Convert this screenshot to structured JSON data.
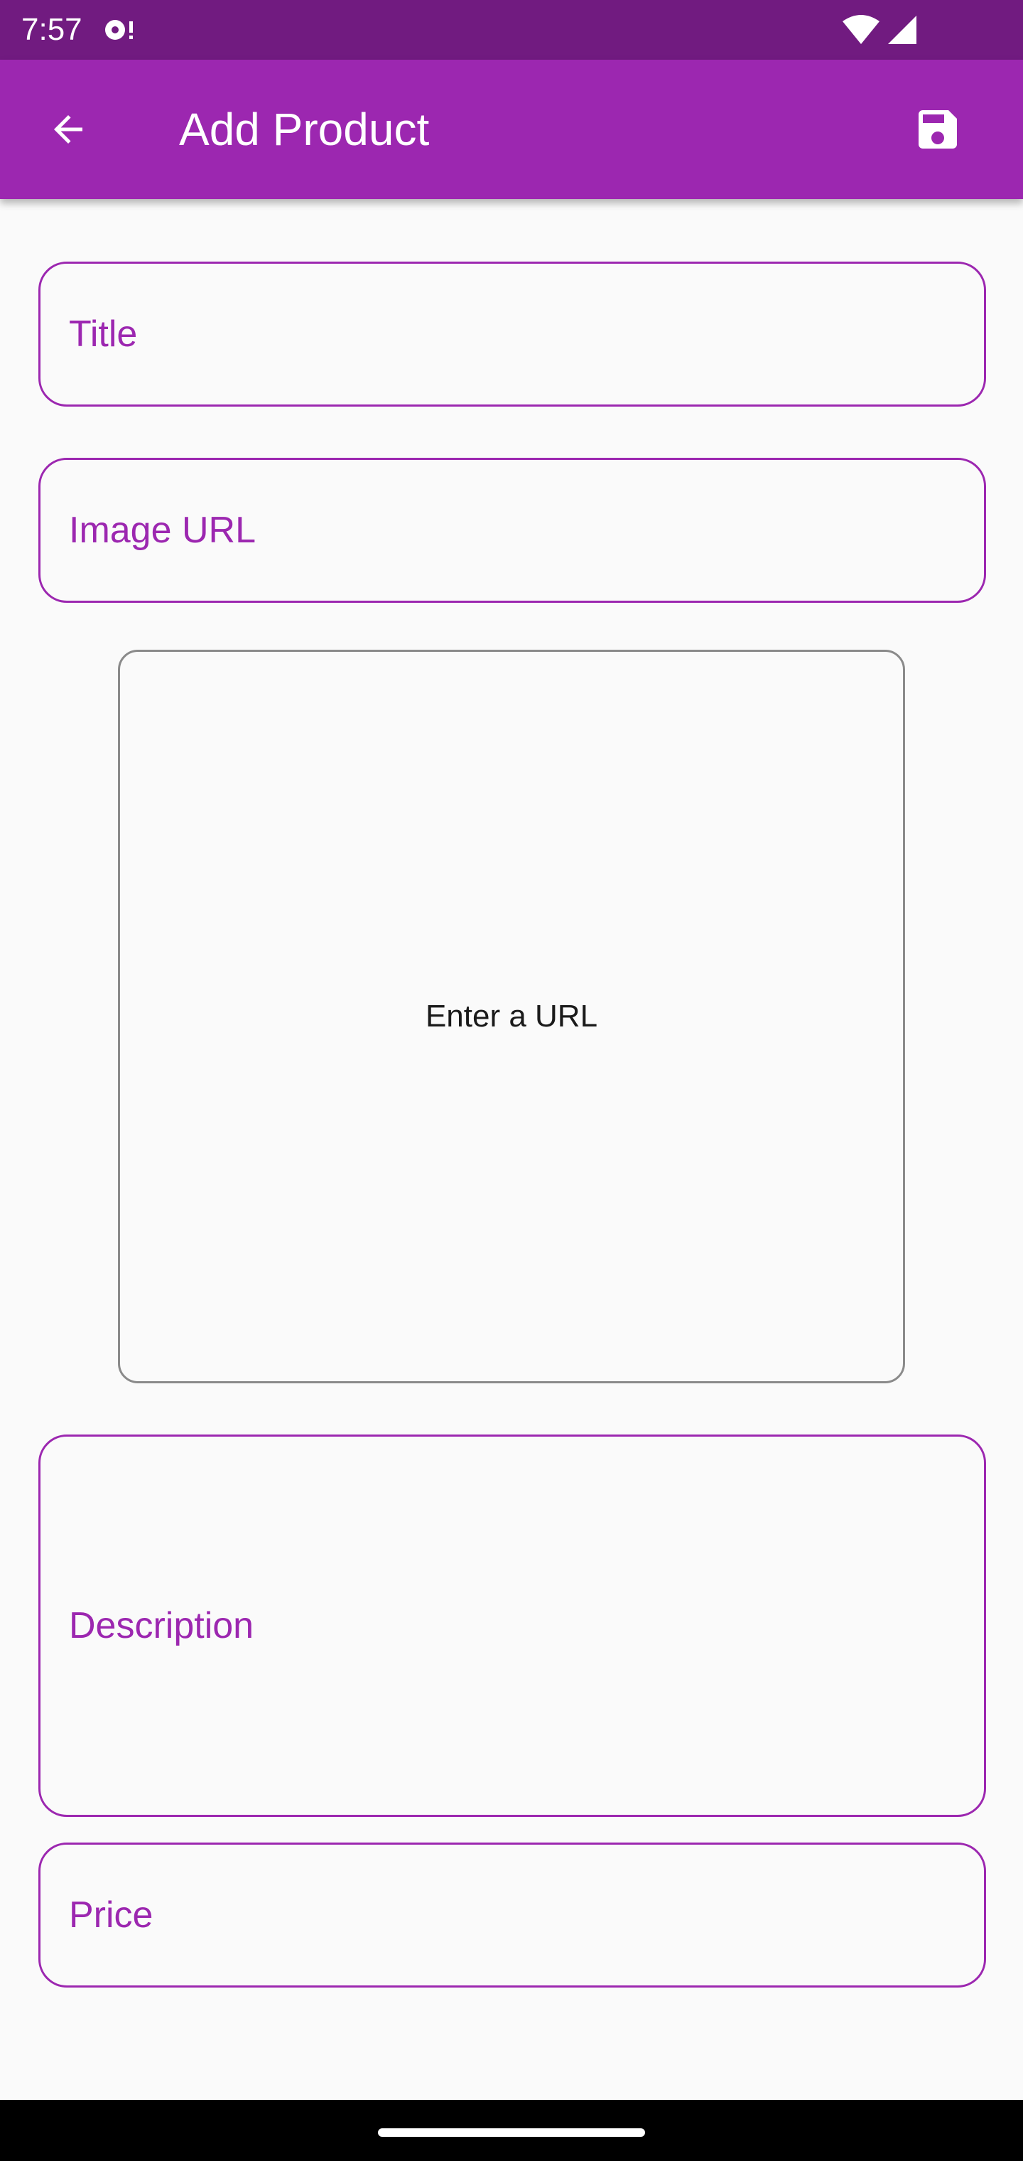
{
  "status_bar": {
    "time": "7:57",
    "icons": [
      "notification-icon",
      "wifi-icon",
      "signal-icon"
    ]
  },
  "app_bar": {
    "title": "Add Product",
    "back_icon": "arrow-back-icon",
    "save_icon": "save-icon",
    "color": "#9c27b0",
    "status_color": "#711b80"
  },
  "form": {
    "title_label": "Title",
    "image_url_label": "Image URL",
    "preview_text": "Enter a URL",
    "description_label": "Description",
    "price_label": "Price",
    "accent_color": "#9c27b0"
  }
}
